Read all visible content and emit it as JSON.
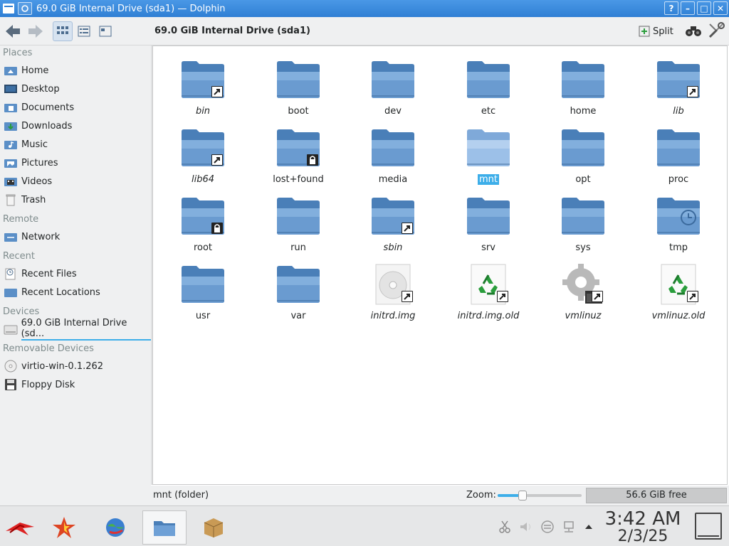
{
  "window": {
    "title": "69.0 GiB Internal Drive (sda1) — Dolphin",
    "controls": [
      "?",
      "–",
      "□",
      "✕"
    ]
  },
  "toolbar": {
    "location": "69.0 GiB Internal Drive (sda1)",
    "split_label": "Split"
  },
  "sidebar": {
    "sections": [
      {
        "title": "Places",
        "items": [
          {
            "label": "Home",
            "icon": "home-icon"
          },
          {
            "label": "Desktop",
            "icon": "desktop-icon"
          },
          {
            "label": "Documents",
            "icon": "documents-icon"
          },
          {
            "label": "Downloads",
            "icon": "downloads-icon"
          },
          {
            "label": "Music",
            "icon": "music-icon"
          },
          {
            "label": "Pictures",
            "icon": "pictures-icon"
          },
          {
            "label": "Videos",
            "icon": "videos-icon"
          },
          {
            "label": "Trash",
            "icon": "trash-icon"
          }
        ]
      },
      {
        "title": "Remote",
        "items": [
          {
            "label": "Network",
            "icon": "network-icon"
          }
        ]
      },
      {
        "title": "Recent",
        "items": [
          {
            "label": "Recent Files",
            "icon": "recent-files-icon"
          },
          {
            "label": "Recent Locations",
            "icon": "recent-locations-icon"
          }
        ]
      },
      {
        "title": "Devices",
        "items": [
          {
            "label": "69.0 GiB Internal Drive (sd...",
            "icon": "hard-drive-icon",
            "selected": true
          }
        ]
      },
      {
        "title": "Removable Devices",
        "items": [
          {
            "label": "virtio-win-0.1.262",
            "icon": "optical-disc-icon"
          },
          {
            "label": "Floppy Disk",
            "icon": "floppy-disk-icon"
          }
        ]
      }
    ]
  },
  "files": [
    {
      "name": "bin",
      "type": "folder",
      "link": true
    },
    {
      "name": "boot",
      "type": "folder"
    },
    {
      "name": "dev",
      "type": "folder"
    },
    {
      "name": "etc",
      "type": "folder"
    },
    {
      "name": "home",
      "type": "folder"
    },
    {
      "name": "lib",
      "type": "folder",
      "link": true
    },
    {
      "name": "lib64",
      "type": "folder",
      "link": true
    },
    {
      "name": "lost+found",
      "type": "folder",
      "locked": true
    },
    {
      "name": "media",
      "type": "folder"
    },
    {
      "name": "mnt",
      "type": "folder",
      "selected": true
    },
    {
      "name": "opt",
      "type": "folder"
    },
    {
      "name": "proc",
      "type": "folder"
    },
    {
      "name": "root",
      "type": "folder",
      "locked": true
    },
    {
      "name": "run",
      "type": "folder"
    },
    {
      "name": "sbin",
      "type": "folder",
      "link": true
    },
    {
      "name": "srv",
      "type": "folder"
    },
    {
      "name": "sys",
      "type": "folder"
    },
    {
      "name": "tmp",
      "type": "folder-temp"
    },
    {
      "name": "usr",
      "type": "folder"
    },
    {
      "name": "var",
      "type": "folder"
    },
    {
      "name": "initrd.img",
      "type": "disc-image",
      "link": true
    },
    {
      "name": "initrd.img.old",
      "type": "recycle-file",
      "link": true
    },
    {
      "name": "vmlinuz",
      "type": "executable",
      "link": true
    },
    {
      "name": "vmlinuz.old",
      "type": "recycle-file",
      "link": true
    }
  ],
  "statusbar": {
    "status": "mnt (folder)",
    "zoom_label": "Zoom:",
    "zoom_level": 0.27,
    "free_space": "56.6 GiB free"
  },
  "taskbar": {
    "time": "3:42 AM",
    "date": "2/3/25"
  },
  "colors": {
    "accent": "#3daee9",
    "folder": "#5b8fc7",
    "titlebar": "#3a8ade"
  }
}
